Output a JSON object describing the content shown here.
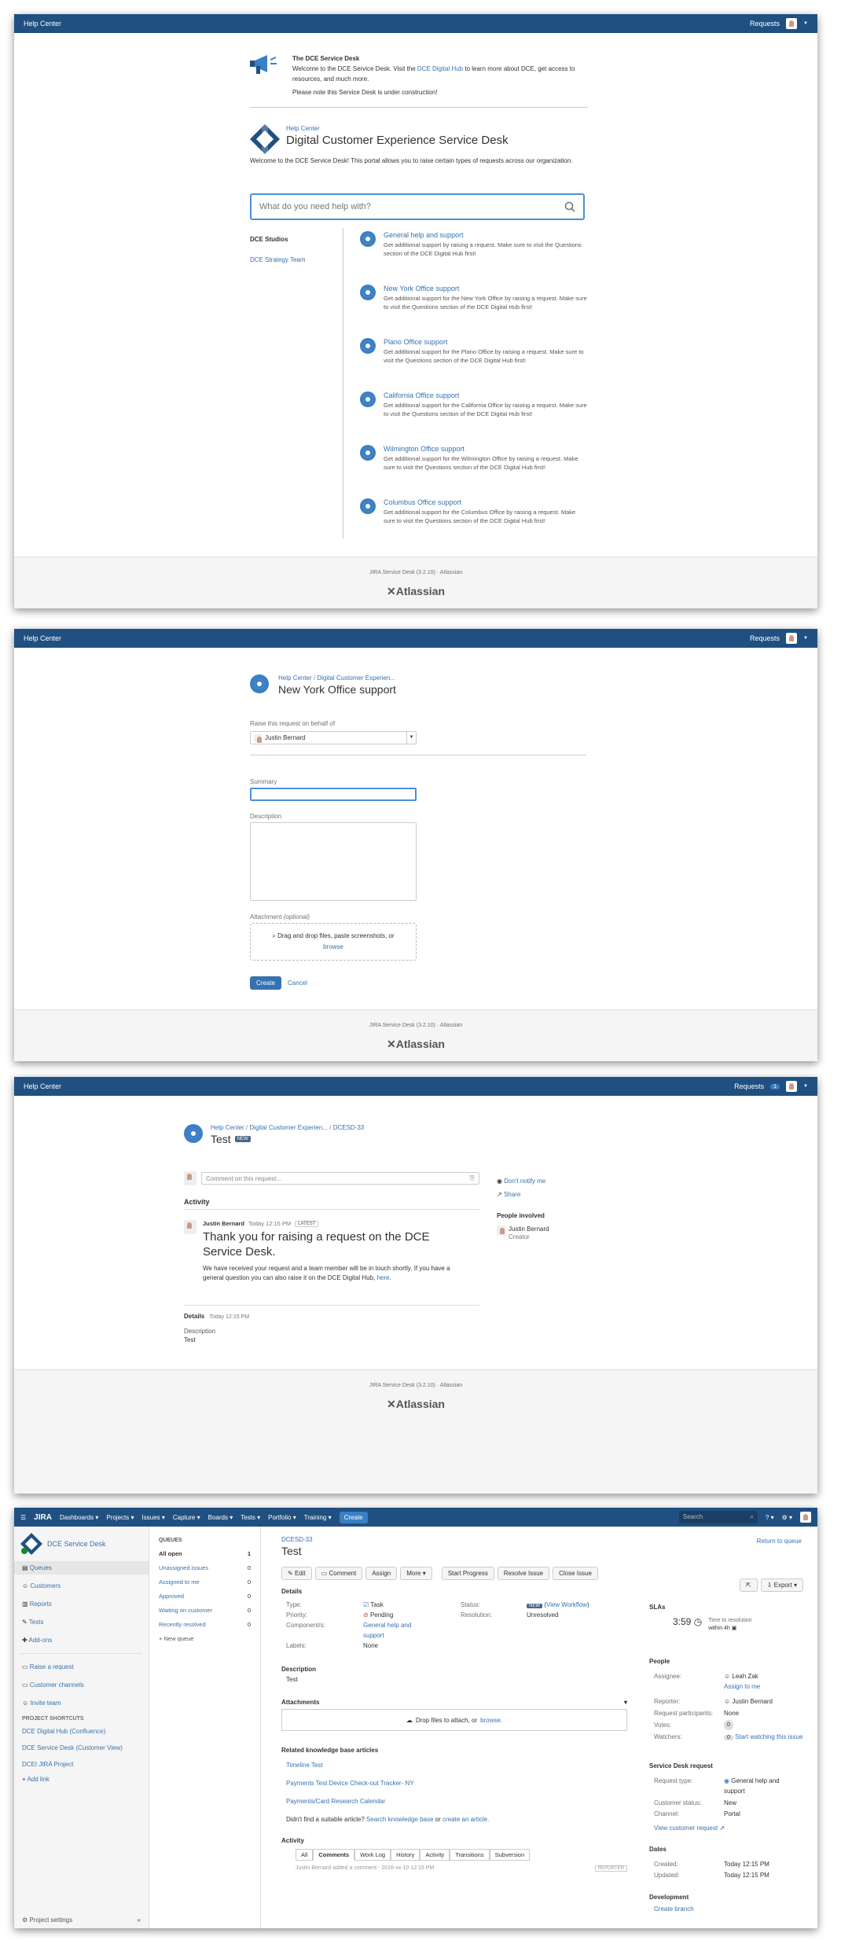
{
  "s1": {
    "header": {
      "brand": "Help Center",
      "requests": "Requests"
    },
    "announcement": {
      "title": "The DCE Service Desk",
      "line1_pre": "Welcome to the DCE Service Desk. Visit the ",
      "link": "DCE Digital Hub",
      "line1_post": " to learn more about DCE, get access to resources, and much more.",
      "line2": "Please note this Service Desk is under construction!"
    },
    "breadcrumb": "Help Center",
    "title": "Digital Customer Experience Service Desk",
    "intro": "Welcome to the DCE Service Desk! This portal allows you to raise certain types of requests across our organization.",
    "search_placeholder": "What do you need help with?",
    "groups": {
      "heading": "DCE Studios",
      "link": "DCE Strategy Team"
    },
    "types": [
      {
        "name": "General help and support",
        "desc": "Get additional support by raising a request. Make sure to visit the Questions section of the DCE Digital Hub first!"
      },
      {
        "name": "New York Office support",
        "desc": "Get additional support for the New York Office by raising a request. Make sure to visit the Questions section of the DCE Digital Hub first!"
      },
      {
        "name": "Plano Office support",
        "desc": "Get additional support for the Plano Office by raising a request. Make sure to visit the Questions section of the DCE Digital Hub first!"
      },
      {
        "name": "California Office support",
        "desc": "Get additional support for the California Office by raising a request. Make sure to visit the Questions section of the DCE Digital Hub first!"
      },
      {
        "name": "Wilmington Office support",
        "desc": "Get additional support for the Wilmington Office by raising a request. Make sure to visit the Questions section of the DCE Digital Hub first!"
      },
      {
        "name": "Columbus Office support",
        "desc": "Get additional support for the Columbus Office by raising a request. Make sure to visit the Questions section of the DCE Digital Hub first!"
      }
    ],
    "footer": {
      "version": "JIRA Service Desk (3.2.10)",
      "sep": "·",
      "vendor": "Atlassian",
      "logo": "Atlassian"
    }
  },
  "s2": {
    "header": {
      "brand": "Help Center",
      "requests": "Requests"
    },
    "crumb1": "Help Center",
    "crumb_sep": "/",
    "crumb2": "Digital Customer Experien...",
    "title": "New York Office support",
    "behalf_label": "Raise this request on behalf of",
    "behalf_value": "Justin Bernard",
    "summary_label": "Summary",
    "description_label": "Description",
    "attachment_label": "Attachment",
    "attachment_optional": "(optional)",
    "drop_text": "Drag and drop files, paste screenshots, or",
    "browse": "browse",
    "create": "Create",
    "cancel": "Cancel",
    "footer": {
      "version": "JIRA Service Desk (3.2.10)",
      "sep": "·",
      "vendor": "Atlassian",
      "logo": "Atlassian"
    }
  },
  "s3": {
    "header": {
      "brand": "Help Center",
      "requests": "Requests",
      "count": "1"
    },
    "crumb1": "Help Center",
    "crumb2": "Digital Customer Experien...",
    "crumb3": "DCESD-33",
    "crumb_sep": "/",
    "title": "Test",
    "badge": "NEW",
    "comment_placeholder": "Comment on this request...",
    "activity": "Activity",
    "author": "Justin Bernard",
    "time": "Today 12:15 PM",
    "latest": "LATEST",
    "message": "Thank you for raising a request on the DCE Service Desk.",
    "body_pre": "We have received your request and a team member will be in touch shortly. If you have a general question you can also raise it on the DCE Digital Hub, ",
    "body_link": "here",
    "body_post": ".",
    "details": "Details",
    "details_time": "Today 12:15 PM",
    "desc_label": "Description",
    "desc_value": "Test",
    "notify": "Don't notify me",
    "share": "Share",
    "people_heading": "People involved",
    "person": "Justin Bernard",
    "person_role": "Creator",
    "footer": {
      "version": "JIRA Service Desk (3.2.10)",
      "sep": "·",
      "vendor": "Atlassian",
      "logo": "Atlassian"
    }
  },
  "s4": {
    "nav": {
      "logo": "JIRA",
      "items": [
        "Dashboards",
        "Projects",
        "Issues",
        "Capture",
        "Boards",
        "Tests",
        "Portfolio",
        "Training"
      ],
      "create": "Create",
      "search": "Search"
    },
    "sidebar": {
      "project": "DCE Service Desk",
      "items": [
        "Queues",
        "Customers",
        "Reports",
        "Tests",
        "Add-ons"
      ],
      "items2": [
        "Raise a request",
        "Customer channels",
        "Invite team"
      ],
      "shortcuts_heading": "PROJECT SHORTCUTS",
      "shortcuts": [
        "DCE Digital Hub (Confluence)",
        "DCE Service Desk (Customer View)",
        "DCEI JIRA Project"
      ],
      "add_link": "Add link",
      "settings": "Project settings"
    },
    "queues": {
      "heading": "QUEUES",
      "items": [
        {
          "label": "All open",
          "count": "1"
        },
        {
          "label": "Unassigned issues",
          "count": "0"
        },
        {
          "label": "Assigned to me",
          "count": "0"
        },
        {
          "label": "Approved",
          "count": "0"
        },
        {
          "label": "Waiting on customer",
          "count": "0"
        },
        {
          "label": "Recently resolved",
          "count": "0"
        }
      ],
      "new_queue": "New queue"
    },
    "issue": {
      "key": "DCESD-33",
      "return": "Return to queue",
      "title": "Test",
      "toolbar": [
        "Edit",
        "Comment",
        "Assign",
        "More",
        "Start Progress",
        "Resolve Issue",
        "Close Issue"
      ],
      "export": "Export",
      "details_heading": "Details",
      "type_label": "Type:",
      "type_value": "Task",
      "priority_label": "Priority:",
      "priority_value": "Pending",
      "components_label": "Component/s:",
      "components_value": "General help and support",
      "labels_label": "Labels:",
      "labels_value": "None",
      "status_label": "Status:",
      "status_badge": "NEW",
      "status_link": "View Workflow",
      "resolution_label": "Resolution:",
      "resolution_value": "Unresolved",
      "description_heading": "Description",
      "description_value": "Test",
      "attachments_heading": "Attachments",
      "drop_text": "Drop files to attach, or",
      "browse": "browse.",
      "kb_heading": "Related knowledge base articles",
      "kb_articles": [
        "Timeline Test",
        "Payments Test Device Check-out Tracker- NY",
        "Payments/Card Research Calendar"
      ],
      "kb_prompt": "Didn't find a suitable article?",
      "kb_search": "Search knowledge base",
      "kb_or": "or",
      "kb_create": "create an article",
      "activity_heading": "Activity",
      "activity_tabs": [
        "All",
        "Comments",
        "Work Log",
        "History",
        "Activity",
        "Transitions",
        "Subversion"
      ],
      "activity_peek": "Justin Bernard added a comment - 2016-xx-10 12:15 PM",
      "reporter_tag": "REPORTER"
    },
    "right": {
      "slas_heading": "SLAs",
      "sla_time": "3:59",
      "sla_label": "Time to resolution",
      "sla_within": "within 4h",
      "people_heading": "People",
      "assignee_label": "Assignee:",
      "assignee_value": "Leah Zak",
      "assign_me": "Assign to me",
      "reporter_label": "Reporter:",
      "reporter_value": "Justin Bernard",
      "participants_label": "Request participants:",
      "participants_value": "None",
      "votes_label": "Votes:",
      "votes_value": "0",
      "watchers_label": "Watchers:",
      "watchers_value": "0",
      "watch_link": "Start watching this issue",
      "sd_heading": "Service Desk request",
      "req_type_label": "Request type:",
      "req_type_value": "General help and support",
      "cust_status_label": "Customer status:",
      "cust_status_value": "New",
      "channel_label": "Channel:",
      "channel_value": "Portal",
      "view_request": "View customer request",
      "dates_heading": "Dates",
      "created_label": "Created:",
      "created_value": "Today 12:15 PM",
      "updated_label": "Updated:",
      "updated_value": "Today 12:15 PM",
      "dev_heading": "Development",
      "dev_link": "Create branch"
    }
  }
}
